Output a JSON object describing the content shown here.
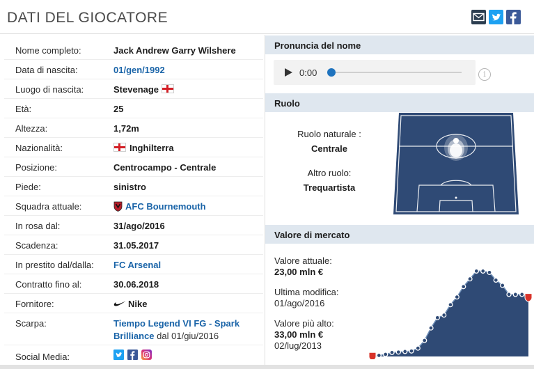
{
  "header": {
    "title": "DATI DEL GIOCATORE",
    "share_icons": [
      "mail-icon",
      "twitter-icon",
      "facebook-icon"
    ]
  },
  "player": {
    "rows": [
      {
        "label": "Nome completo:",
        "value": "Jack Andrew Garry Wilshere"
      },
      {
        "label": "Data di nascita:",
        "value": "01/gen/1992",
        "link": true
      },
      {
        "label": "Luogo di nascita:",
        "value": "Stevenage",
        "flag": "england"
      },
      {
        "label": "Età:",
        "value": "25"
      },
      {
        "label": "Altezza:",
        "value": "1,72m"
      },
      {
        "label": "Nazionalità:",
        "value": "Inghilterra",
        "flag_before": "england"
      },
      {
        "label": "Posizione:",
        "value": "Centrocampo - Centrale"
      },
      {
        "label": "Piede:",
        "value": "sinistro"
      },
      {
        "label": "Squadra attuale:",
        "value": "AFC Bournemouth",
        "link": true,
        "icon": "club-crest-icon"
      },
      {
        "label": "In rosa dal:",
        "value": "31/ago/2016"
      },
      {
        "label": "Scadenza:",
        "value": "31.05.2017"
      },
      {
        "label": "In prestito dal/dalla:",
        "value": "FC Arsenal",
        "link": true
      },
      {
        "label": "Contratto fino al:",
        "value": "30.06.2018"
      },
      {
        "label": "Fornitore:",
        "value": "Nike",
        "icon": "nike-swoosh-icon"
      }
    ],
    "boot": {
      "label": "Scarpa:",
      "line1": "Tiempo Legend VI FG - Spark",
      "line2": "Brilliance",
      "since": "dal 01/giu/2016"
    },
    "social": {
      "label": "Social Media:",
      "icons": [
        "twitter-icon",
        "facebook-icon",
        "instagram-icon"
      ]
    }
  },
  "pronunciation": {
    "title": "Pronuncia del nome",
    "time": "0:00",
    "progress": 0
  },
  "role": {
    "title": "Ruolo",
    "natural_label": "Ruolo naturale :",
    "natural_value": "Centrale",
    "other_label": "Altro ruolo:",
    "other_value": "Trequartista"
  },
  "market": {
    "title": "Valore di mercato",
    "current_label": "Valore attuale:",
    "current_value": "23,00 mln €",
    "modified_label": "Ultima modifica:",
    "modified_value": "01/ago/2016",
    "highest_label": "Valore più alto:",
    "highest_value": "33,00 mln €",
    "highest_date": "02/lug/2013"
  },
  "chart_data": {
    "type": "area",
    "values": [
      0.2,
      0.4,
      0.8,
      1.5,
      1.7,
      1.9,
      2.1,
      3.2,
      6.2,
      11,
      15,
      16,
      20,
      23,
      27,
      30,
      33,
      33,
      32.5,
      29.5,
      27.5,
      24,
      24,
      24,
      23
    ],
    "ylim": [
      0,
      35
    ],
    "fill": "#2f4a75",
    "stroke": "#6f8fb8",
    "point": "#2f4a75",
    "crest_color": "#d8332a"
  },
  "colors": {
    "link": "#1a64a8",
    "section_head": "#dfe7ef",
    "pitch": "#2f4a75"
  }
}
